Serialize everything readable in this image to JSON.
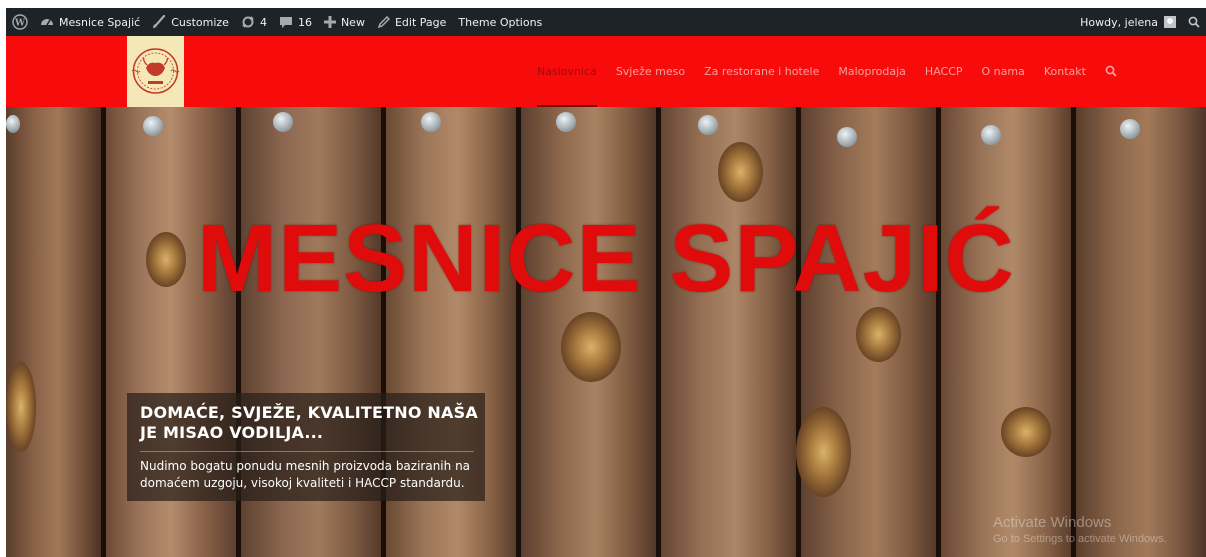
{
  "adminbar": {
    "wp_logo_icon": "wordpress-icon",
    "site_name": "Mesnice Spajić",
    "customize": "Customize",
    "updates_count": "4",
    "comments_count": "16",
    "new_label": "New",
    "edit_page": "Edit Page",
    "theme_options": "Theme Options",
    "greeting": "Howdy, jelena",
    "colors": {
      "bar": "#1d2327",
      "text": "#f0f0f1"
    }
  },
  "header": {
    "logo_icon": "bull-emblem-logo",
    "nav": [
      {
        "label": "Naslovnica",
        "active": true
      },
      {
        "label": "Svježe meso",
        "active": false
      },
      {
        "label": "Za restorane i hotele",
        "active": false
      },
      {
        "label": "Maloprodaja",
        "active": false
      },
      {
        "label": "HACCP",
        "active": false
      },
      {
        "label": "O nama",
        "active": false
      },
      {
        "label": "Kontakt",
        "active": false
      }
    ],
    "colors": {
      "background": "#f80b0b",
      "link": "#f4a19b",
      "active_link": "#a30a0a"
    }
  },
  "hero": {
    "title": "MESNICE SPAJIĆ",
    "caption_heading": "DOMAĆE, SVJEŽE, KVALITETNO NAŠA JE MISAO VODILJA...",
    "caption_text": "Nudimo bogatu ponudu mesnih proizvoda baziranih na domaćem uzgoju, visokoj kvaliteti i HACCP standardu.",
    "colors": {
      "title": "#e00b0b"
    }
  },
  "watermark": {
    "line1": "Activate Windows",
    "line2": "Go to Settings to activate Windows."
  }
}
